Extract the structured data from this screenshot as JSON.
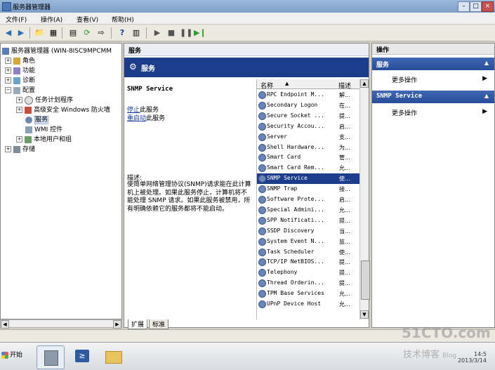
{
  "window": {
    "title": "服务器管理器"
  },
  "menu": [
    "文件(F)",
    "操作(A)",
    "查看(V)",
    "帮助(H)"
  ],
  "tree": {
    "root": "服务器管理器 (WIN-8ISC9MPCMM",
    "items": [
      {
        "label": "角色",
        "level": 1,
        "expander": "+"
      },
      {
        "label": "功能",
        "level": 1,
        "expander": "+"
      },
      {
        "label": "诊断",
        "level": 1,
        "expander": "+"
      },
      {
        "label": "配置",
        "level": 1,
        "expander": "−"
      },
      {
        "label": "任务计划程序",
        "level": 2,
        "expander": "+"
      },
      {
        "label": "高级安全 Windows 防火墙",
        "level": 2,
        "expander": "+"
      },
      {
        "label": "服务",
        "level": 2,
        "expander": "",
        "selected": true
      },
      {
        "label": "WMI 控件",
        "level": 2,
        "expander": ""
      },
      {
        "label": "本地用户和组",
        "level": 2,
        "expander": "+"
      },
      {
        "label": "存储",
        "level": 1,
        "expander": "+"
      }
    ]
  },
  "center": {
    "header": "服务",
    "banner": "服务",
    "detail": {
      "service_name": "SNMP Service",
      "stop_link": "停止",
      "stop_suffix": "此服务",
      "restart_link": "重启动",
      "restart_suffix": "此服务",
      "desc_label": "描述:",
      "description": "使简单网络管理协议(SNMP)请求能在此计算机上被处理。如果此服务停止，计算机将不能处理 SNMP 请求。如果此服务被禁用，所有明确依赖它的服务都将不能启动。"
    },
    "columns": {
      "name": "名称",
      "desc": "描述"
    },
    "services": [
      {
        "name": "RPC Endpoint M...",
        "desc": "解..."
      },
      {
        "name": "Secondary Logon",
        "desc": "在..."
      },
      {
        "name": "Secure Socket ...",
        "desc": "提..."
      },
      {
        "name": "Security Accou...",
        "desc": "启..."
      },
      {
        "name": "Server",
        "desc": "支..."
      },
      {
        "name": "Shell Hardware...",
        "desc": "为..."
      },
      {
        "name": "Smart Card",
        "desc": "管..."
      },
      {
        "name": "Smart Card Rem...",
        "desc": "允..."
      },
      {
        "name": "SNMP Service",
        "desc": "使...",
        "selected": true
      },
      {
        "name": "SNMP Trap",
        "desc": "接..."
      },
      {
        "name": "Software Prote...",
        "desc": "启..."
      },
      {
        "name": "Special Admini...",
        "desc": "允..."
      },
      {
        "name": "SPP Notificati...",
        "desc": "提..."
      },
      {
        "name": "SSDP Discovery",
        "desc": "当..."
      },
      {
        "name": "System Event N...",
        "desc": "监..."
      },
      {
        "name": "Task Scheduler",
        "desc": "使..."
      },
      {
        "name": "TCP/IP NetBIOS...",
        "desc": "提..."
      },
      {
        "name": "Telephony",
        "desc": "提..."
      },
      {
        "name": "Thread Orderin...",
        "desc": "提..."
      },
      {
        "name": "TPM Base Services",
        "desc": "允..."
      },
      {
        "name": "UPnP Device Host",
        "desc": "允..."
      }
    ],
    "tabs": [
      "扩展",
      "标准"
    ]
  },
  "actions": {
    "header": "操作",
    "sections": [
      {
        "title": "服务",
        "item": "更多操作"
      },
      {
        "title": "SNMP Service",
        "item": "更多操作"
      }
    ]
  },
  "taskbar": {
    "start": "开始",
    "time": "14:5",
    "date": "2013/3/14"
  },
  "watermark": {
    "line1": "51CTO.com",
    "line2": "技术博客",
    "line3": "Blog"
  },
  "colors": {
    "selection": "#1b3d8b",
    "action_bar": "#3f67b3"
  }
}
